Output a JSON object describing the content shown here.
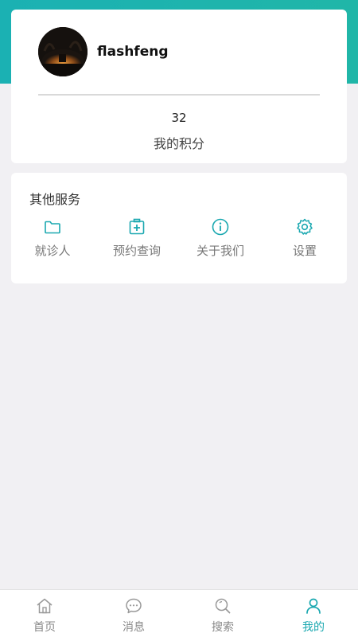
{
  "profile": {
    "username": "flashfeng",
    "points_value": "32",
    "points_label": "我的积分"
  },
  "services": {
    "title": "其他服务",
    "items": [
      {
        "label": "就诊人",
        "icon": "folder-icon"
      },
      {
        "label": "预约查询",
        "icon": "medical-kit-icon"
      },
      {
        "label": "关于我们",
        "icon": "info-icon"
      },
      {
        "label": "设置",
        "icon": "gear-icon"
      }
    ]
  },
  "tabbar": {
    "items": [
      {
        "label": "首页",
        "icon": "home-icon"
      },
      {
        "label": "消息",
        "icon": "message-icon"
      },
      {
        "label": "搜索",
        "icon": "search-icon"
      },
      {
        "label": "我的",
        "icon": "user-icon",
        "active": true
      }
    ]
  },
  "colors": {
    "accent": "#1aa8b0",
    "header": "#1bb1b3",
    "background": "#f1f0f3"
  }
}
